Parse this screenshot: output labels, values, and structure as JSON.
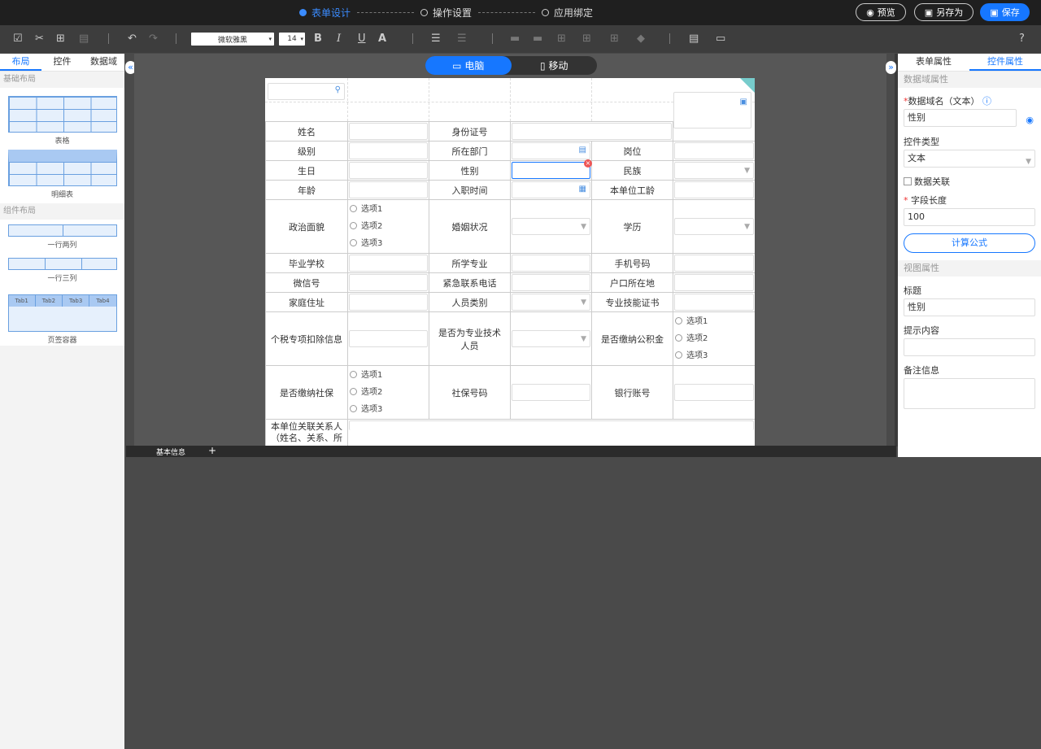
{
  "steps": [
    "表单设计",
    "操作设置",
    "应用绑定"
  ],
  "top_buttons": {
    "preview": "预览",
    "save_as": "另存为",
    "save": "保存"
  },
  "toolbar": {
    "font_family": "微软雅黑",
    "font_size": "14",
    "bold": "B",
    "italic": "I",
    "underline": "U",
    "font_color": "A"
  },
  "left_panel": {
    "tabs": [
      "布局",
      "控件",
      "数据域"
    ],
    "section_basic": "基础布局",
    "section_component": "组件布局",
    "items": {
      "table": "表格",
      "detail": "明细表",
      "two_col": "一行两列",
      "three_col": "一行三列",
      "tab_container": "页签容器"
    },
    "tab_labels": [
      "Tab1",
      "Tab2",
      "Tab3",
      "Tab4"
    ]
  },
  "device": {
    "pc": "电脑",
    "mobile": "移动"
  },
  "form": {
    "row1": [
      "姓名",
      "身份证号"
    ],
    "row2": [
      "级别",
      "所在部门",
      "岗位"
    ],
    "row3": [
      "生日",
      "性别",
      "民族"
    ],
    "row4": [
      "年龄",
      "入职时间",
      "本单位工龄"
    ],
    "row5": [
      "政治面貌",
      "婚姻状况",
      "学历"
    ],
    "options": [
      "选项1",
      "选项2",
      "选项3"
    ],
    "row6": [
      "毕业学校",
      "所学专业",
      "手机号码"
    ],
    "row7": [
      "微信号",
      "紧急联系电话",
      "户口所在地"
    ],
    "row8": [
      "家庭住址",
      "人员类别",
      "专业技能证书"
    ],
    "row9": [
      "个税专项扣除信息",
      "是否为专业技术人员",
      "是否缴纳公积金"
    ],
    "row10": [
      "是否缴纳社保",
      "社保号码",
      "银行账号"
    ],
    "row11": [
      "本单位关联关系人（姓名、关系、所"
    ]
  },
  "bottom": {
    "tab": "基本信息",
    "add": "+"
  },
  "right_panel": {
    "tabs": [
      "表单属性",
      "控件属性"
    ],
    "section_data": "数据域属性",
    "data_domain_label": "数据域名（文本）",
    "data_domain_value": "性别",
    "control_type_label": "控件类型",
    "control_type_value": "文本",
    "data_link_label": "数据关联",
    "field_length_label": "字段长度",
    "field_length_value": "100",
    "formula_button": "计算公式",
    "section_view": "视图属性",
    "title_label": "标题",
    "title_value": "性别",
    "hint_label": "提示内容",
    "hint_value": "",
    "remark_label": "备注信息",
    "remark_value": ""
  }
}
